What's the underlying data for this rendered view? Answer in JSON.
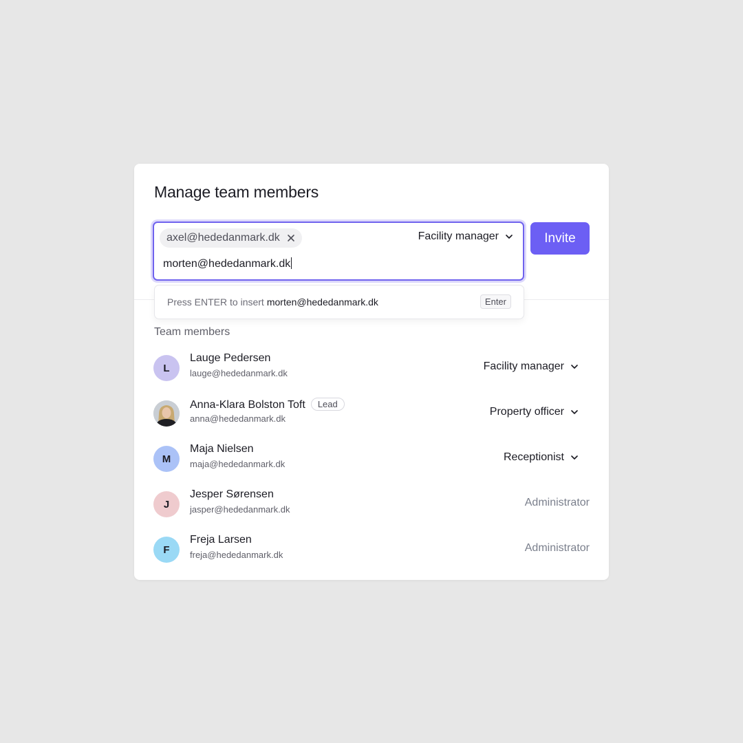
{
  "dialog": {
    "title": "Manage team members"
  },
  "invite": {
    "chip_email": "axel@hededanmark.dk",
    "role": "Facility manager",
    "typed_value": "morten@hededanmark.dk",
    "button_label": "Invite"
  },
  "suggestion": {
    "prefix": "Press ENTER to insert",
    "email": "morten@hededanmark.dk",
    "key": "Enter"
  },
  "team": {
    "label": "Team members",
    "members": [
      {
        "initial": "L",
        "name": "Lauge Pedersen",
        "email": "lauge@hededanmark.dk",
        "role": "Facility manager",
        "avatar_color": "#c9c3f0"
      },
      {
        "initial": "",
        "name": "Anna-Klara Bolston Toft",
        "badge": "Lead",
        "email": "anna@hededanmark.dk",
        "role": "Property officer",
        "avatar_color": "#b8a78f"
      },
      {
        "initial": "M",
        "name": "Maja Nielsen",
        "email": "maja@hededanmark.dk",
        "role": "Receptionist",
        "avatar_color": "#abc2f7"
      },
      {
        "initial": "J",
        "name": "Jesper Sørensen",
        "email": "jasper@hededanmark.dk",
        "role": "Administrator",
        "avatar_color": "#efcbce"
      },
      {
        "initial": "F",
        "name": "Freja Larsen",
        "email": "freja@hededanmark.dk",
        "role": "Administrator",
        "avatar_color": "#9ad9f5"
      }
    ]
  },
  "colors": {
    "accent": "#6c5ff4",
    "background": "#e7e7e7",
    "card": "#ffffff"
  }
}
